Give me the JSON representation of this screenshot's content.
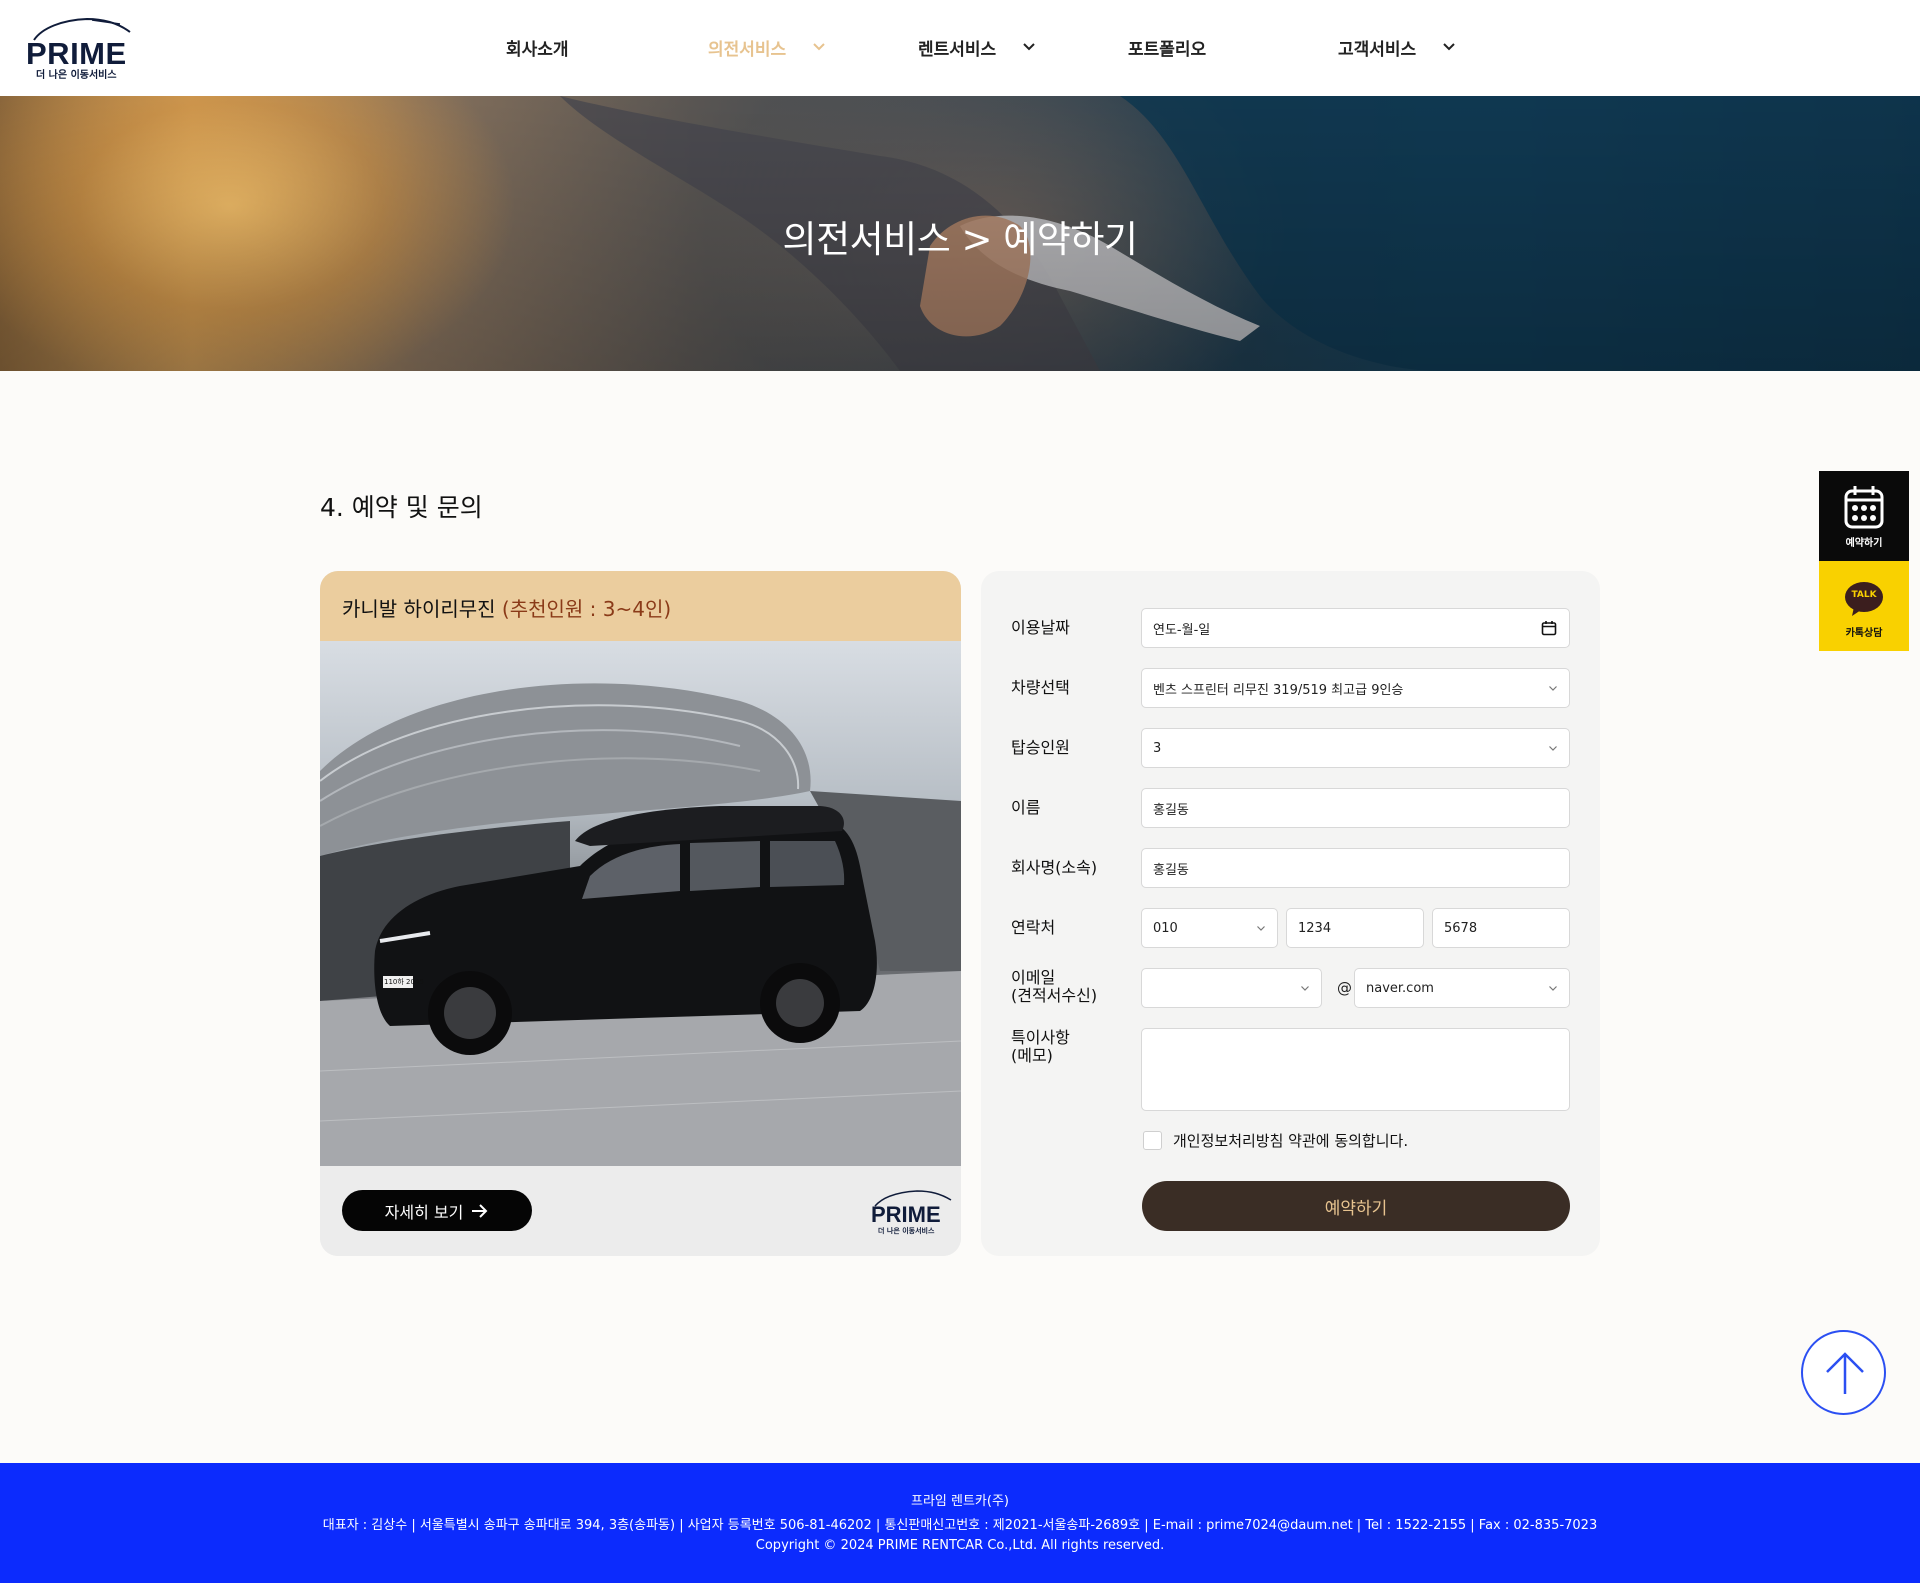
{
  "header": {
    "logo_text": "PRIME",
    "logo_sub": "더 나은 이동서비스",
    "nav": [
      {
        "label": "회사소개",
        "has_dropdown": false,
        "active": false
      },
      {
        "label": "의전서비스",
        "has_dropdown": true,
        "active": true
      },
      {
        "label": "렌트서비스",
        "has_dropdown": true,
        "active": false
      },
      {
        "label": "포트폴리오",
        "has_dropdown": false,
        "active": false
      },
      {
        "label": "고객서비스",
        "has_dropdown": true,
        "active": false
      }
    ]
  },
  "hero": {
    "title": "의전서비스 > 예약하기"
  },
  "section": {
    "title": "4. 예약 및 문의"
  },
  "card": {
    "title": "카니발 하이리무진",
    "recommend": "(추천인원 : 3~4인)",
    "detail_button": "자세히 보기",
    "logo_text": "PRIME",
    "logo_sub": "더 나은 이동서비스",
    "plate_text": "110하 2045"
  },
  "form": {
    "date": {
      "label": "이용날짜",
      "value": "연도-월-일"
    },
    "vehicle": {
      "label": "차량선택",
      "value": "벤츠 스프린터 리무진 319/519 최고급 9인승"
    },
    "passengers": {
      "label": "탑승인원",
      "value": "3"
    },
    "name": {
      "label": "이름",
      "value": "홍길동"
    },
    "company": {
      "label": "회사명(소속)",
      "value": "홍길동"
    },
    "phone": {
      "label": "연락처",
      "part1": "010",
      "part2": "1234",
      "part3": "5678"
    },
    "email": {
      "label_line1": "이메일",
      "label_line2": "(견적서수신)",
      "local": "",
      "at": "@",
      "domain": "naver.com"
    },
    "memo": {
      "label_line1": "특이사항",
      "label_line2": "(메모)",
      "value": ""
    },
    "agree_text": "개인정보처리방침 약관에 동의합니다.",
    "agree_checked": false,
    "submit_label": "예약하기"
  },
  "side": {
    "reserve_label": "예약하기",
    "kakao_label": "카톡상담",
    "kakao_badge": "TALK"
  },
  "footer": {
    "company": "프라임 렌트카(주)",
    "info": "대표자 : 김상수 | 서울특별시 송파구 송파대로 394, 3층(송파동) | 사업자 등록번호 506-81-46202 | 통신판매신고번호 : 제2021-서울송파-2689호 | E-mail : prime7024@daum.net | Tel : 1522-2155 | Fax : 02-835-7023",
    "copyright": "Copyright © 2024 PRIME RENTCAR Co.,Ltd. All rights reserved."
  },
  "colors": {
    "accent_gold": "#e7c38f",
    "card_header": "#ebcd9e",
    "submit_bg": "#3a2d25",
    "footer_bg": "#0c2bfd",
    "kakao_yellow": "#f9d100",
    "navy": "#101c3a"
  }
}
